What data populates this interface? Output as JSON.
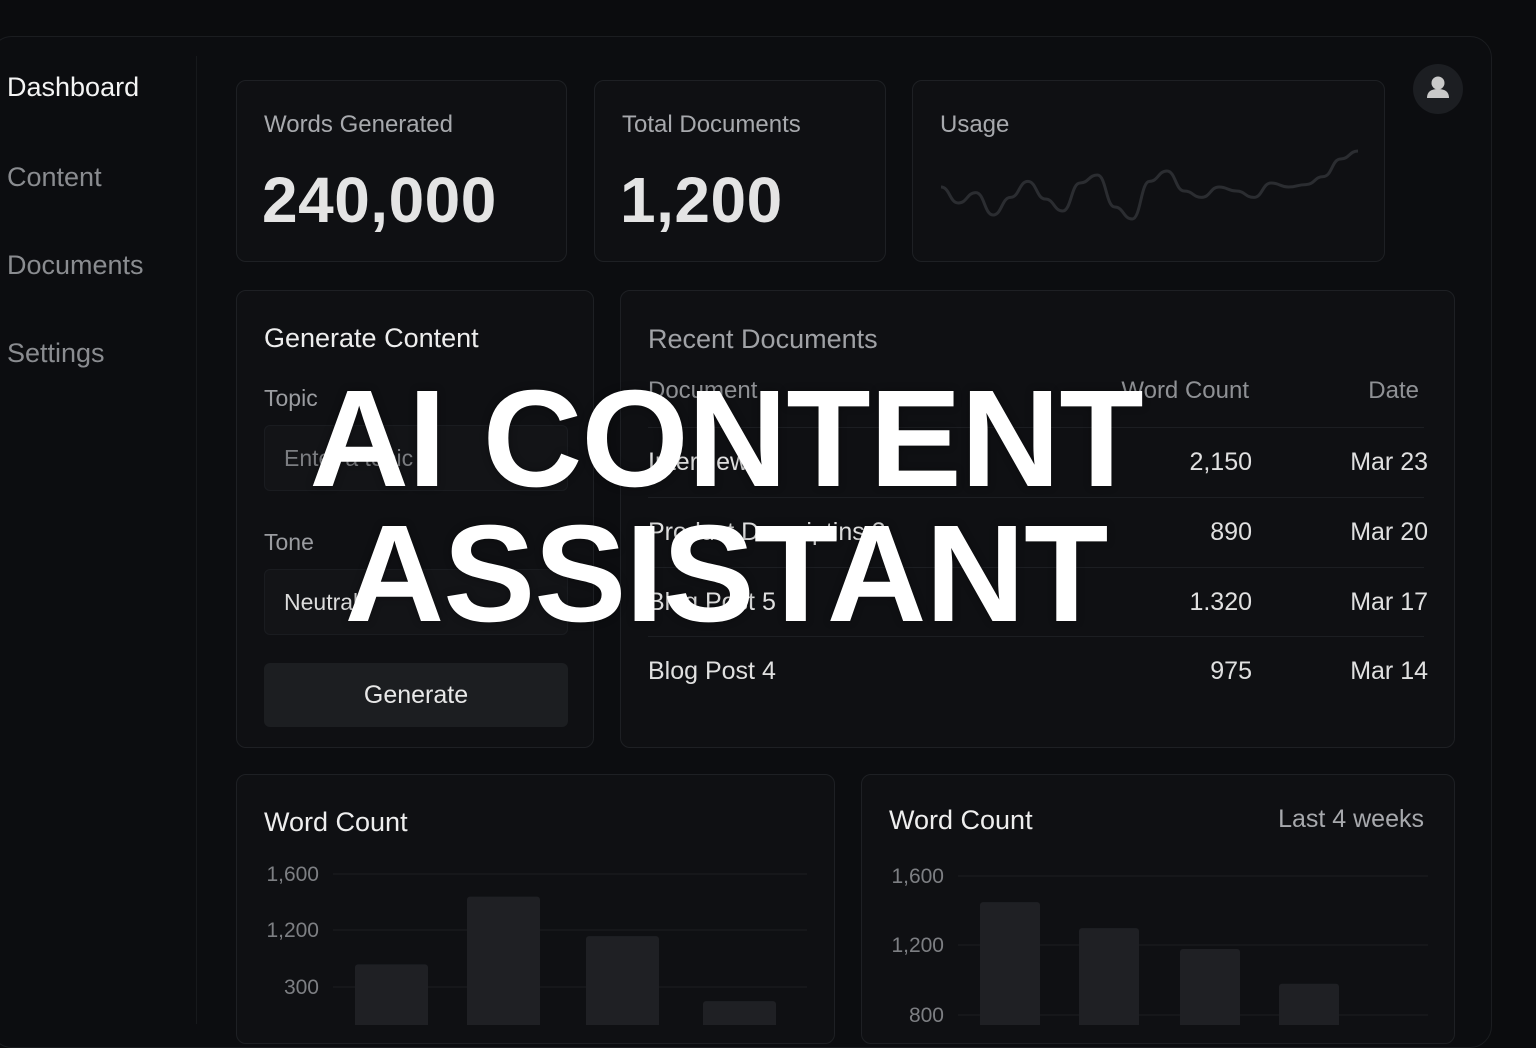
{
  "sidebar": {
    "items": [
      {
        "label": "Dashboard",
        "active": true
      },
      {
        "label": "Content",
        "active": false
      },
      {
        "label": "Documents",
        "active": false
      },
      {
        "label": "Settings",
        "active": false
      }
    ]
  },
  "stats": {
    "words_generated": {
      "label": "Words Generated",
      "value": "240,000"
    },
    "total_documents": {
      "label": "Total Documents",
      "value": "1,200"
    },
    "usage": {
      "label": "Usage"
    }
  },
  "header": {
    "avatar_icon": "user-icon"
  },
  "generate": {
    "title": "Generate Content",
    "topic_label": "Topic",
    "topic_placeholder": "Enter a topic",
    "tone_label": "Tone",
    "tone_value": "Neutral",
    "button_label": "Generate"
  },
  "recent": {
    "title": "Recent Documents",
    "columns": [
      "Document",
      "Word Count",
      "Date"
    ],
    "rows": [
      {
        "document": "Interview",
        "word_count": "2,150",
        "date": "Mar 23"
      },
      {
        "document": "Product Descriptins 3",
        "word_count": "890",
        "date": "Mar 20"
      },
      {
        "document": "Blog Post 5",
        "word_count": "1.320",
        "date": "Mar 17"
      },
      {
        "document": "Blog Post 4",
        "word_count": "975",
        "date": "Mar 14"
      }
    ]
  },
  "overlay": {
    "line1": "AI CONTENT",
    "line2": "ASSISTANT"
  },
  "colors": {
    "background": "#0b0c0e",
    "card": "#0f1013",
    "bar": "#1f2024",
    "text": "#e0e0e0"
  },
  "chart_data": [
    {
      "type": "line",
      "title": "Usage",
      "series": [
        {
          "values": [
            0.55,
            0.35,
            0.48,
            0.2,
            0.42,
            0.62,
            0.4,
            0.25,
            0.6,
            0.7,
            0.3,
            0.15,
            0.62,
            0.75,
            0.5,
            0.42,
            0.55,
            0.5,
            0.42,
            0.6,
            0.55,
            0.58,
            0.68,
            0.9,
            1.0
          ]
        }
      ],
      "grid": false
    },
    {
      "type": "bar",
      "title": "Word Count",
      "ytick_labels": [
        "1,600",
        "1,200",
        "300"
      ],
      "values": [
        960,
        1440,
        1160,
        700
      ],
      "grid": true
    },
    {
      "type": "bar",
      "title": "Word Count",
      "subtitle": "Last 4 weeks",
      "ytick_labels": [
        "1,600",
        "1,200",
        "800"
      ],
      "yticks": [
        1600,
        1200,
        800
      ],
      "values": [
        1450,
        1300,
        1180,
        980
      ],
      "grid": true
    }
  ]
}
